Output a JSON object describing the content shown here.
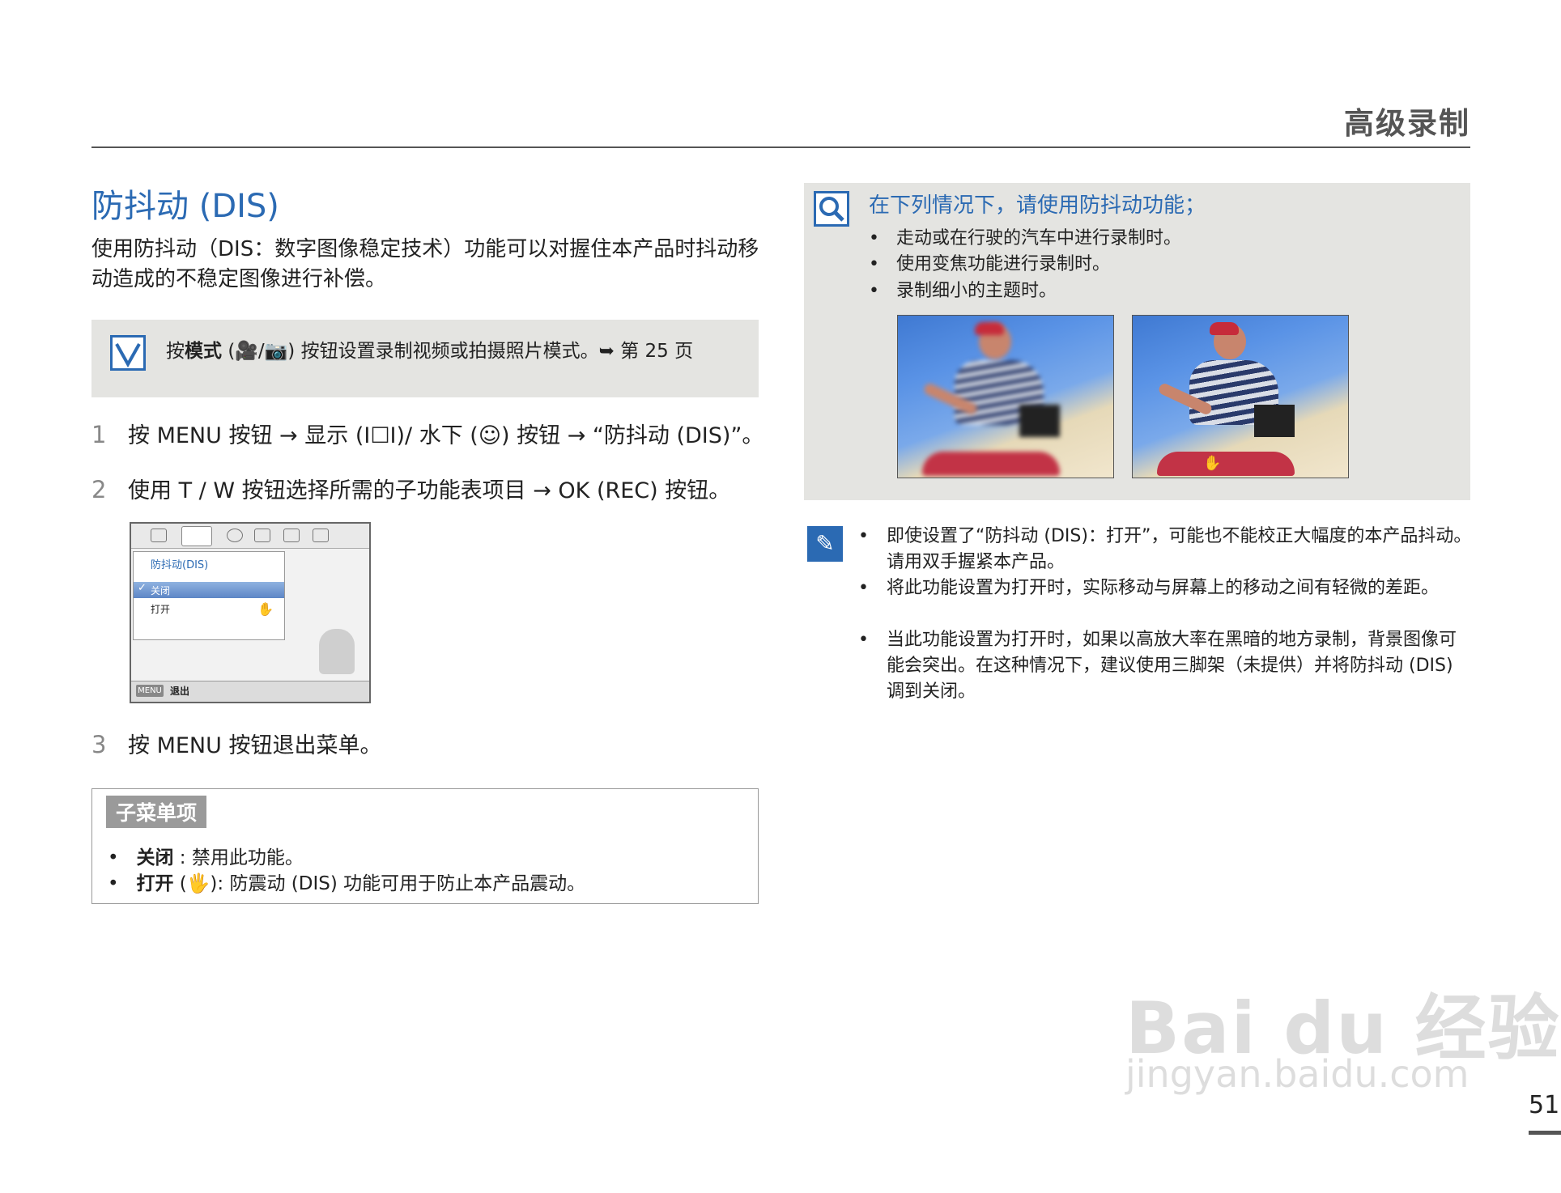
{
  "header": {
    "section": "高级录制",
    "page_number": "51"
  },
  "main": {
    "title": "防抖动 (DIS)",
    "intro": "使用防抖动（DIS：数字图像稳定技术）功能可以对握住本产品时抖动移动造成的不稳定图像进行补偿。",
    "tip": {
      "prefix": "按",
      "bold": "模式",
      "suffix": "(🎥/📷) 按钮设置录制视频或拍摄照片模式。➥ 第 25 页"
    },
    "steps": [
      {
        "num": "1",
        "text": "按 MENU 按钮 → 显示 (I☐I)/ 水下 (☺) 按钮 → “防抖动 (DIS)”。"
      },
      {
        "num": "2",
        "text": "使用 T / W 按钮选择所需的子功能表项目 → OK (REC) 按钮。"
      },
      {
        "num": "3",
        "text": "按 MENU 按钮退出菜单。"
      }
    ],
    "lcd": {
      "header": "防抖动(DIS)",
      "options": [
        "关闭",
        "打开"
      ],
      "menu_label": "MENU",
      "exit": "退出"
    },
    "submenu": {
      "title": "子菜单项",
      "items": [
        {
          "label": "关闭",
          "desc": " : 禁用此功能。"
        },
        {
          "label": "打开",
          "desc": " (🖐): 防震动 (DIS) 功能可用于防止本产品震动。"
        }
      ]
    }
  },
  "side": {
    "heading": "在下列情况下，请使用防抖动功能；",
    "bullets": [
      "走动或在行驶的汽车中进行录制时。",
      "使用变焦功能进行录制时。",
      "录制细小的主题时。"
    ],
    "notes": [
      "即使设置了“防抖动 (DIS)：打开”，可能也不能校正大幅度的本产品抖动。请用双手握紧本产品。",
      "将此功能设置为打开时，实际移动与屏幕上的移动之间有轻微的差距。",
      "当此功能设置为打开时，如果以高放大率在黑暗的地方录制，背景图像可能会突出。在这种情况下，建议使用三脚架（未提供）并将防抖动 (DIS) 调到关闭。"
    ]
  },
  "watermark": {
    "main": "Bai du 经验",
    "sub": "jingyan.baidu.com"
  },
  "colors": {
    "accent": "#2b6ab3",
    "panel": "#e4e4e1"
  },
  "icons": [
    "magnifier-icon",
    "checkmark-icon",
    "pen-note-icon",
    "hand-stabilizer-icon"
  ]
}
